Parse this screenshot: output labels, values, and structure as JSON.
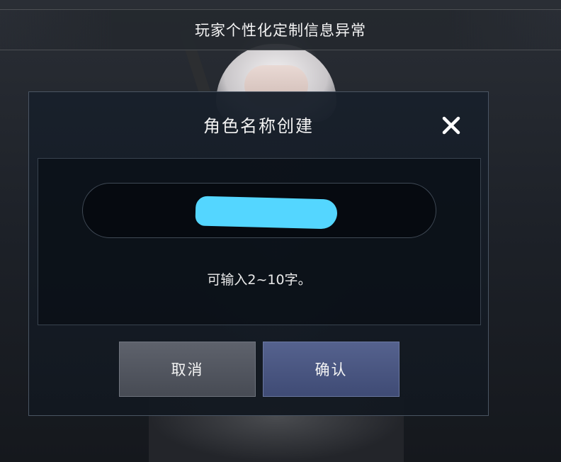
{
  "banner": {
    "text": "玩家个性化定制信息异常"
  },
  "dialog": {
    "title": "角色名称创建",
    "close_icon": "close-icon",
    "name_input": {
      "value": "",
      "redacted": true,
      "redaction_color": "#54d6ff"
    },
    "hint": "可输入2~10字。",
    "cancel_label": "取消",
    "confirm_label": "确认"
  },
  "colors": {
    "dialog_bg": "#18202b",
    "confirm_button": "#4b5782",
    "cancel_button": "#545861"
  }
}
